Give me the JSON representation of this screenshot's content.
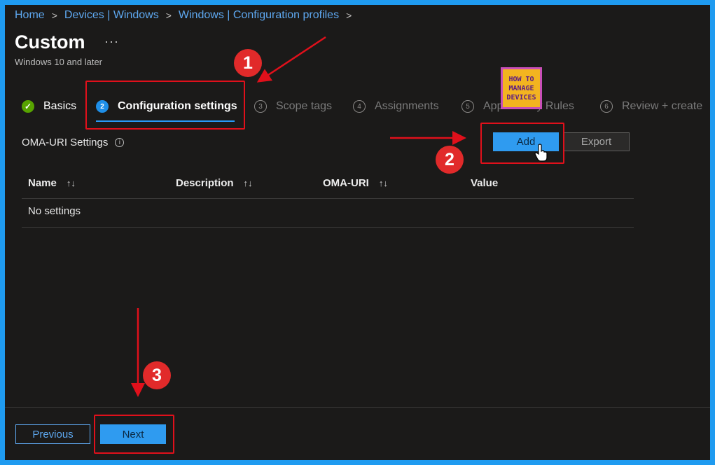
{
  "breadcrumb": [
    "Home",
    "Devices | Windows",
    "Windows | Configuration profiles"
  ],
  "page": {
    "title": "Custom",
    "subtitle": "Windows 10 and later",
    "more": "···"
  },
  "steps": [
    {
      "num": "✓",
      "label": "Basics",
      "state": "done"
    },
    {
      "num": "2",
      "label": "Configuration settings",
      "state": "active"
    },
    {
      "num": "3",
      "label": "Scope tags",
      "state": "pending"
    },
    {
      "num": "4",
      "label": "Assignments",
      "state": "pending"
    },
    {
      "num": "5",
      "label": "Applicability Rules",
      "state": "pending"
    },
    {
      "num": "6",
      "label": "Review + create",
      "state": "pending"
    }
  ],
  "section": {
    "label": "OMA-URI Settings",
    "info": "i",
    "add_label": "Add",
    "export_label": "Export"
  },
  "table": {
    "columns": [
      "Name",
      "Description",
      "OMA-URI",
      "Value"
    ],
    "sort_icon": "↑↓",
    "empty_text": "No settings"
  },
  "footer": {
    "previous_label": "Previous",
    "next_label": "Next"
  },
  "annotations": {
    "badge_1": "1",
    "badge_2": "2",
    "badge_3": "3",
    "color": "#e0101b"
  },
  "logo": {
    "line1": "HOW TO",
    "line2": "MANAGE",
    "line3": "DEVICES"
  },
  "colors": {
    "accent": "#2f9bf0",
    "link": "#5ea8f0",
    "success": "#57a300",
    "background": "#1b1a19"
  }
}
